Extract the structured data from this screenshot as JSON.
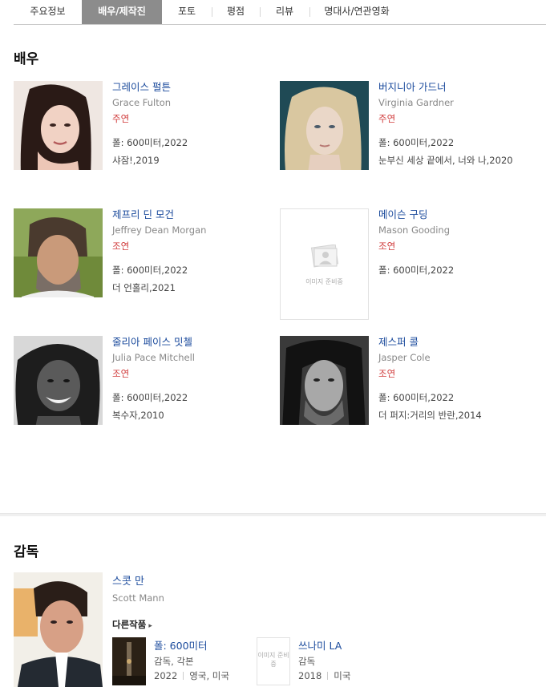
{
  "tabs": [
    {
      "label": "주요정보"
    },
    {
      "label": "배우/제작진"
    },
    {
      "label": "포토"
    },
    {
      "label": "평점"
    },
    {
      "label": "리뷰"
    },
    {
      "label": "명대사/연관영화"
    }
  ],
  "actors_section": {
    "title": "배우",
    "actors": [
      {
        "kname": "그레이스 펄튼",
        "ename": "Grace Fulton",
        "role": "주연",
        "works": [
          "폴: 600미터,2022",
          "샤잠!,2019"
        ]
      },
      {
        "kname": "버지니아 가드너",
        "ename": "Virginia Gardner",
        "role": "주연",
        "works": [
          "폴: 600미터,2022",
          "눈부신 세상 끝에서, 너와 나,2020"
        ]
      },
      {
        "kname": "제프리 딘 모건",
        "ename": "Jeffrey Dean Morgan",
        "role": "조연",
        "works": [
          "폴: 600미터,2022",
          "더 언홀리,2021"
        ]
      },
      {
        "kname": "메이슨 구딩",
        "ename": "Mason Gooding",
        "role": "조연",
        "works": [
          "폴: 600미터,2022"
        ],
        "placeholder": "이미지 준비중"
      },
      {
        "kname": "줄리아 페이스 밋첼",
        "ename": "Julia Pace Mitchell",
        "role": "조연",
        "works": [
          "폴: 600미터,2022",
          "복수자,2010"
        ]
      },
      {
        "kname": "제스퍼 콜",
        "ename": "Jasper Cole",
        "role": "조연",
        "works": [
          "폴: 600미터,2022",
          "더 퍼지:거리의 반란,2014"
        ]
      }
    ]
  },
  "director_section": {
    "title": "감독",
    "kname": "스콧 만",
    "ename": "Scott Mann",
    "others_label": "다른작품",
    "films": [
      {
        "title": "폴: 600미터",
        "role": "감독, 각본",
        "year": "2022",
        "country": "영국, 미국"
      },
      {
        "title": "쓰나미 LA",
        "role": "감독",
        "year": "2018",
        "country": "미국",
        "placeholder": "이미지 준비중"
      }
    ]
  },
  "colors": {
    "active_tab": "#8c8c8c",
    "name_link": "#1a4a9c",
    "role": "#d03a3a"
  }
}
